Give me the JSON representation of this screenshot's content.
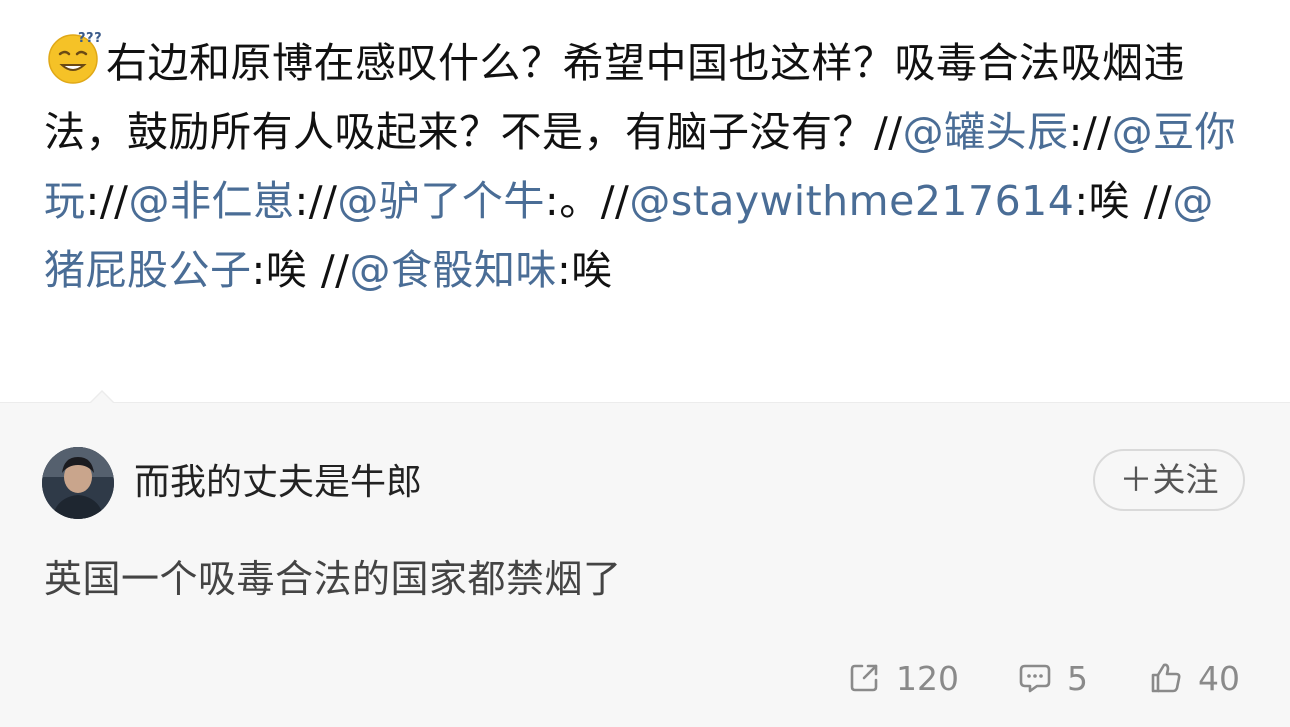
{
  "post": {
    "emoji": "thinking-face-emoji",
    "segments": [
      {
        "text": "右边和原博在感叹什么？希望中国也这样？吸毒合法吸烟违法，鼓励所有人吸起来？不是，有脑子没有？//",
        "mention": false
      },
      {
        "text": "@罐头辰",
        "mention": true
      },
      {
        "text": "://",
        "mention": false
      },
      {
        "text": "@豆你玩",
        "mention": true
      },
      {
        "text": "://",
        "mention": false
      },
      {
        "text": "@非仁崽",
        "mention": true
      },
      {
        "text": "://",
        "mention": false
      },
      {
        "text": "@驴了个牛",
        "mention": true
      },
      {
        "text": ":。//",
        "mention": false
      },
      {
        "text": "@staywithme217614",
        "mention": true
      },
      {
        "text": ":唉 //",
        "mention": false
      },
      {
        "text": "@猪屁股公子",
        "mention": true
      },
      {
        "text": ":唉 //",
        "mention": false
      },
      {
        "text": "@食骰知味",
        "mention": true
      },
      {
        "text": ":唉",
        "mention": false
      }
    ]
  },
  "retweet": {
    "avatar_icon": "user-avatar",
    "username": "而我的丈夫是牛郎",
    "follow_label": "＋关注",
    "content": "英国一个吸毒合法的国家都禁烟了",
    "actions": {
      "repost_count": "120",
      "comment_count": "5",
      "like_count": "40"
    }
  },
  "colors": {
    "mention": "#4a6d96",
    "card_background": "#f7f7f7",
    "text": "#111111",
    "muted": "#8a8a8a"
  }
}
